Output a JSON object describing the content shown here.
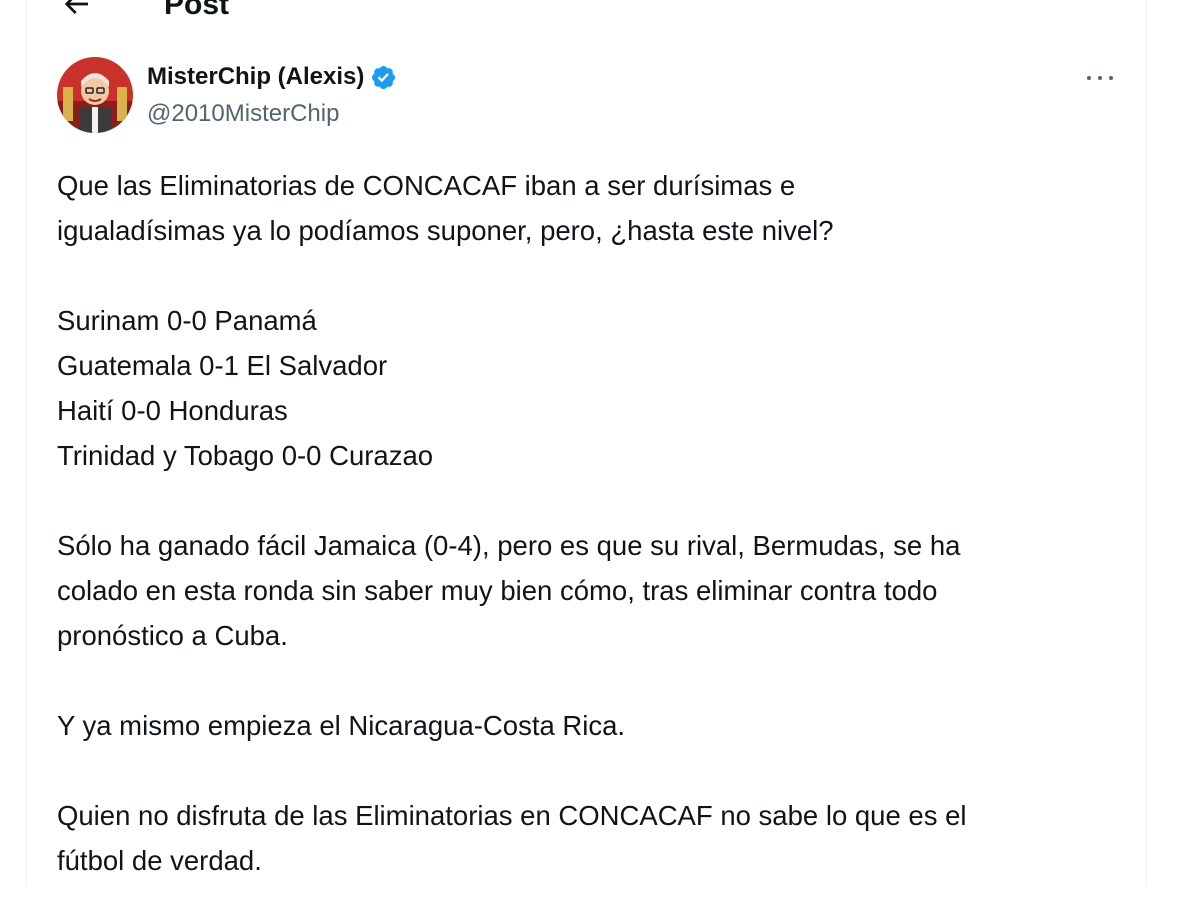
{
  "header": {
    "title": "Post"
  },
  "author": {
    "display_name": "MisterChip (Alexis)",
    "handle": "@2010MisterChip",
    "verified": true,
    "avatar_icon": "avatar-image"
  },
  "tweet": {
    "lines": [
      "Que las Eliminatorias de CONCACAF iban a ser durísimas e",
      "igualadísimas ya lo podíamos suponer, pero, ¿hasta este nivel?",
      "",
      "Surinam 0-0 Panamá",
      "Guatemala 0-1 El Salvador",
      "Haití 0-0 Honduras",
      "Trinidad y Tobago 0-0 Curazao",
      "",
      "Sólo ha ganado fácil Jamaica (0-4), pero es que su rival, Bermudas, se ha",
      "colado en esta ronda sin saber muy bien cómo, tras eliminar contra todo",
      "pronóstico a Cuba.",
      "",
      "Y ya mismo empieza el Nicaragua-Costa Rica.",
      "",
      "Quien no disfruta de las Eliminatorias en CONCACAF no sabe lo que es el",
      "fútbol de verdad."
    ]
  },
  "colors": {
    "verified_blue": "#1d9bf0",
    "text_primary": "#0f1419",
    "text_secondary": "#536471"
  }
}
